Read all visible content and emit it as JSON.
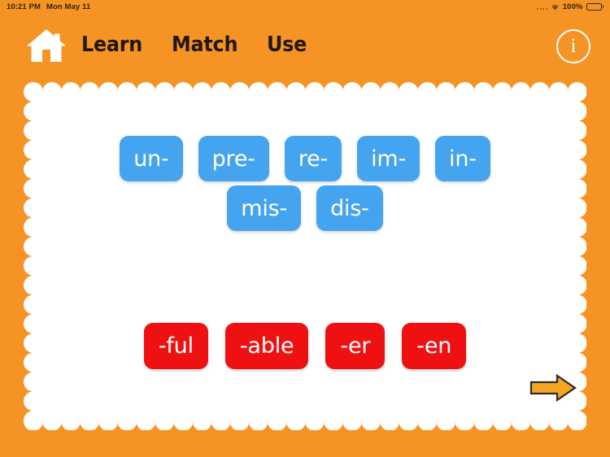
{
  "statusbar": {
    "time": "10:21 PM",
    "date": "Mon May 11",
    "battery_percent": "100%",
    "wifi_icon": "wifi-icon",
    "signal_icon": "signal-dots-icon",
    "battery_icon": "battery-full-icon"
  },
  "header": {
    "home_icon": "home-icon",
    "info_icon": "info-circle-icon",
    "nav": [
      {
        "label": "Learn"
      },
      {
        "label": "Match"
      },
      {
        "label": "Use"
      }
    ]
  },
  "main": {
    "prefix_rows": [
      [
        {
          "label": "un-"
        },
        {
          "label": "pre-"
        },
        {
          "label": "re-"
        },
        {
          "label": "im-"
        },
        {
          "label": "in-"
        }
      ],
      [
        {
          "label": "mis-"
        },
        {
          "label": "dis-"
        }
      ]
    ],
    "suffix_row": [
      {
        "label": "-ful"
      },
      {
        "label": "-able"
      },
      {
        "label": "-er"
      },
      {
        "label": "-en"
      }
    ],
    "next_icon": "arrow-right-icon"
  },
  "colors": {
    "background": "#f59425",
    "card": "#ffffff",
    "prefix_tile": "#45a4ef",
    "suffix_tile": "#ef1111",
    "nav_text": "#231709",
    "arrow_fill": "#f5a623",
    "arrow_stroke": "#2b2b2b"
  }
}
